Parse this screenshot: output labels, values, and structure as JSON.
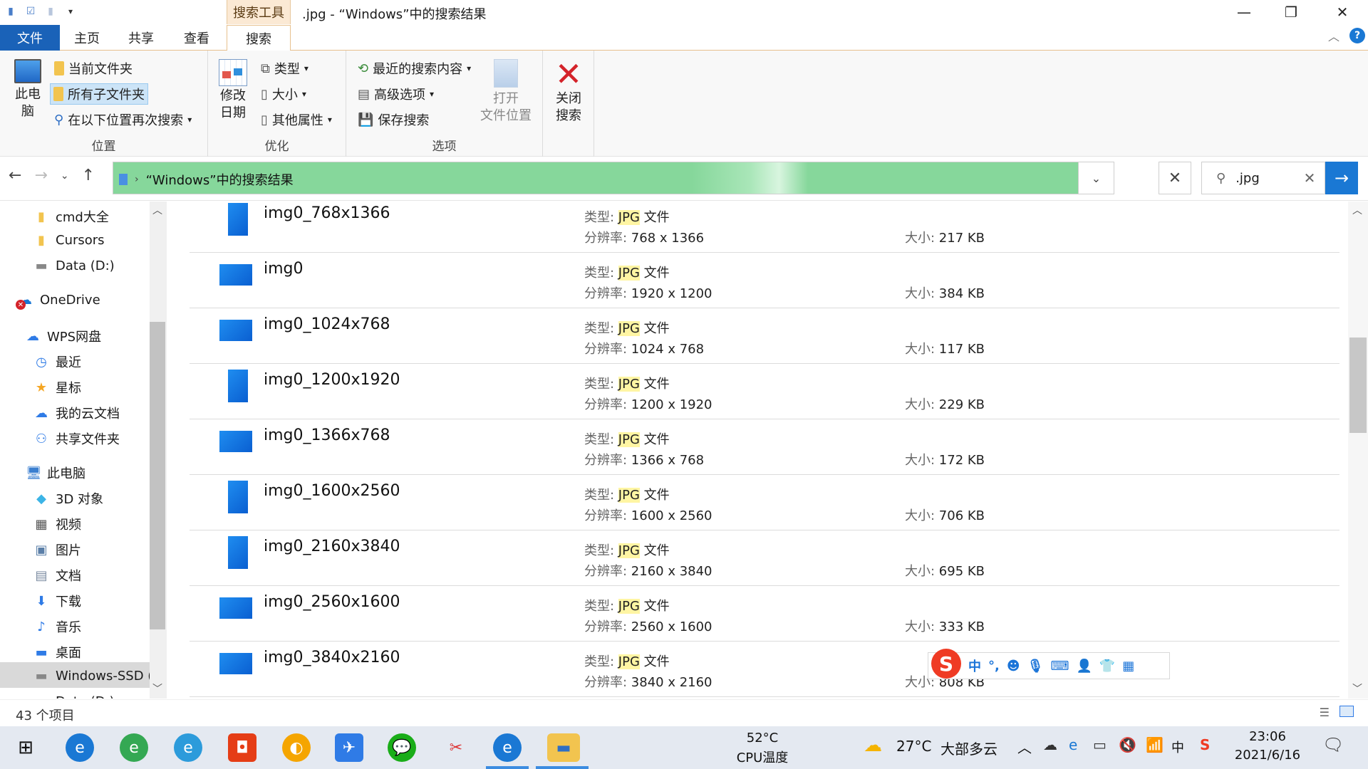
{
  "window": {
    "title": ".jpg - “Windows”中的搜索结果",
    "context_tab": "搜索工具"
  },
  "tabs": [
    "文件",
    "主页",
    "共享",
    "查看",
    "搜索"
  ],
  "ribbon": {
    "location": {
      "label": "位置",
      "this_pc": "此电\n脑",
      "current_folder": "当前文件夹",
      "all_subfolders": "所有子文件夹",
      "search_again": "在以下位置再次搜索"
    },
    "refine": {
      "label": "优化",
      "date_modified": "修改\n日期",
      "type": "类型",
      "size": "大小",
      "other_props": "其他属性"
    },
    "options": {
      "label": "选项",
      "recent_searches": "最近的搜索内容",
      "advanced": "高级选项",
      "save_search": "保存搜索",
      "open_location": "打开\n文件位置",
      "close_search": "关闭\n搜索"
    }
  },
  "address": {
    "path": "“Windows”中的搜索结果"
  },
  "search": {
    "query": ".jpg"
  },
  "nav": {
    "items": [
      {
        "label": "cmd大全",
        "icon": "folder-icon",
        "color": "#f2c44f"
      },
      {
        "label": "Cursors",
        "icon": "folder-icon",
        "color": "#f2c44f"
      },
      {
        "label": "Data (D:)",
        "icon": "drive-icon",
        "color": "#888888"
      },
      {
        "label": "OneDrive",
        "icon": "onedrive-icon",
        "color": "#1a78d4"
      },
      {
        "label": "WPS网盘",
        "icon": "cloud-icon",
        "color": "#2f7be6"
      },
      {
        "label": "最近",
        "icon": "clock-icon",
        "color": "#2f7be6"
      },
      {
        "label": "星标",
        "icon": "star-icon",
        "color": "#f5a623"
      },
      {
        "label": "我的云文档",
        "icon": "cloud-icon",
        "color": "#2f7be6"
      },
      {
        "label": "共享文件夹",
        "icon": "share-icon",
        "color": "#2f7be6"
      },
      {
        "label": "此电脑",
        "icon": "pc-icon",
        "color": "#3b7fd0"
      },
      {
        "label": "3D 对象",
        "icon": "cube-icon",
        "color": "#3cb4e6"
      },
      {
        "label": "视频",
        "icon": "film-icon",
        "color": "#555555"
      },
      {
        "label": "图片",
        "icon": "picture-icon",
        "color": "#5b7fa8"
      },
      {
        "label": "文档",
        "icon": "document-icon",
        "color": "#7a8aa0"
      },
      {
        "label": "下载",
        "icon": "download-icon",
        "color": "#2f7be6"
      },
      {
        "label": "音乐",
        "icon": "music-icon",
        "color": "#2f7be6"
      },
      {
        "label": "桌面",
        "icon": "desktop-icon",
        "color": "#2f7be6"
      },
      {
        "label": "Windows-SSD (",
        "icon": "drive-icon",
        "color": "#888888"
      },
      {
        "label": "Data (D:)",
        "icon": "drive-icon",
        "color": "#888888"
      }
    ]
  },
  "labels": {
    "type_key": "类型: ",
    "type_ext": "JPG",
    "type_suffix": " 文件",
    "res_key": "分辨率: ",
    "size_key": "大小: "
  },
  "files": [
    {
      "name": "img0_768x1366",
      "resolution": "768 x 1366",
      "size": "217 KB",
      "orientation": "portrait"
    },
    {
      "name": "img0",
      "resolution": "1920 x 1200",
      "size": "384 KB",
      "orientation": "landscape"
    },
    {
      "name": "img0_1024x768",
      "resolution": "1024 x 768",
      "size": "117 KB",
      "orientation": "landscape"
    },
    {
      "name": "img0_1200x1920",
      "resolution": "1200 x 1920",
      "size": "229 KB",
      "orientation": "portrait"
    },
    {
      "name": "img0_1366x768",
      "resolution": "1366 x 768",
      "size": "172 KB",
      "orientation": "landscape"
    },
    {
      "name": "img0_1600x2560",
      "resolution": "1600 x 2560",
      "size": "706 KB",
      "orientation": "portrait"
    },
    {
      "name": "img0_2160x3840",
      "resolution": "2160 x 3840",
      "size": "695 KB",
      "orientation": "portrait"
    },
    {
      "name": "img0_2560x1600",
      "resolution": "2560 x 1600",
      "size": "333 KB",
      "orientation": "landscape"
    },
    {
      "name": "img0_3840x2160",
      "resolution": "3840 x 2160",
      "size": "808 KB",
      "orientation": "landscape"
    }
  ],
  "status": {
    "count": "43 个项目"
  },
  "ime": {
    "mode": "中",
    "punct": "°,"
  },
  "taskbar": {
    "cpu_temp": "52°C",
    "cpu_label": "CPU温度",
    "weather_temp": "27°C",
    "weather_desc": "大部多云",
    "tray_lang": "中",
    "time": "23:06",
    "date": "2021/6/16"
  },
  "colors": {
    "file_tab": "#1a62b8",
    "address_highlight": "#86d79b",
    "search_go": "#1a78d4",
    "type_highlight": "#fff5a3"
  }
}
